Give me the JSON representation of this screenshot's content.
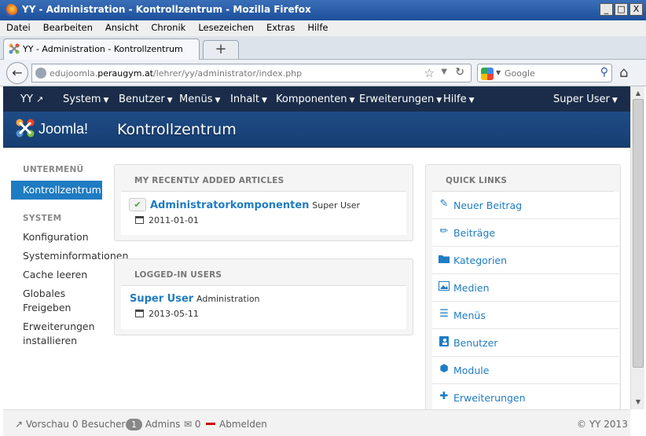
{
  "window": {
    "title": "YY - Administration - Kontrollzentrum - Mozilla Firefox",
    "buttons": [
      "_",
      "□",
      "X"
    ]
  },
  "menubar": [
    "Datei",
    "Bearbeiten",
    "Ansicht",
    "Chronik",
    "Lesezeichen",
    "Extras",
    "Hilfe"
  ],
  "tab": {
    "title": "YY - Administration - Kontrollzentrum",
    "new_tab_label": "+"
  },
  "navbar": {
    "url_prefix": "edujoomla.",
    "url_domain": "peraugym.at",
    "url_path": "/lehrer/yy/administrator/index.php",
    "search_placeholder": "Google"
  },
  "topnav": {
    "site": "YY",
    "items": [
      "System",
      "Benutzer",
      "Menüs",
      "Inhalt",
      "Komponenten",
      "Erweiterungen",
      "Hilfe"
    ],
    "user": "Super User"
  },
  "header": {
    "logo_text": "Joomla!",
    "page_title": "Kontrollzentrum"
  },
  "sidebar": {
    "submenu_heading": "UNTERMENÜ",
    "active_item": "Kontrollzentrum",
    "system_heading": "SYSTEM",
    "system_items": [
      "Konfiguration",
      "Systeminformationen",
      "Cache leeren",
      "Globales",
      "Freigeben",
      "Erweiterungen",
      "installieren"
    ]
  },
  "recent_articles": {
    "heading": "MY RECENTLY ADDED ARTICLES",
    "title": "Administratorkomponenten",
    "author": "Super User",
    "date": "2011-01-01"
  },
  "logged_users": {
    "heading": "LOGGED-IN USERS",
    "name": "Super User",
    "role": "Administration",
    "date": "2013-05-11"
  },
  "quick_links": {
    "heading": "QUICK LINKS",
    "items": [
      {
        "label": "Neuer Beitrag",
        "icon": "new-article-icon"
      },
      {
        "label": "Beiträge",
        "icon": "pencil-icon"
      },
      {
        "label": "Kategorien",
        "icon": "folder-icon"
      },
      {
        "label": "Medien",
        "icon": "image-icon"
      },
      {
        "label": "Menüs",
        "icon": "list-icon"
      },
      {
        "label": "Benutzer",
        "icon": "user-icon"
      },
      {
        "label": "Module",
        "icon": "cube-icon"
      },
      {
        "label": "Erweiterungen",
        "icon": "puzzle-icon"
      }
    ]
  },
  "statusbar": {
    "preview": "Vorschau",
    "visitors_count": "0",
    "visitors_label": "Besucher",
    "admins_count": "1",
    "admins_label": "Admins",
    "messages_count": "0",
    "logout": "Abmelden",
    "copyright": "© YY 2013"
  },
  "colors": {
    "accent": "#1f7cc2",
    "topnav_bg": "#1a2c49",
    "header_bg": "#1f4c86"
  }
}
